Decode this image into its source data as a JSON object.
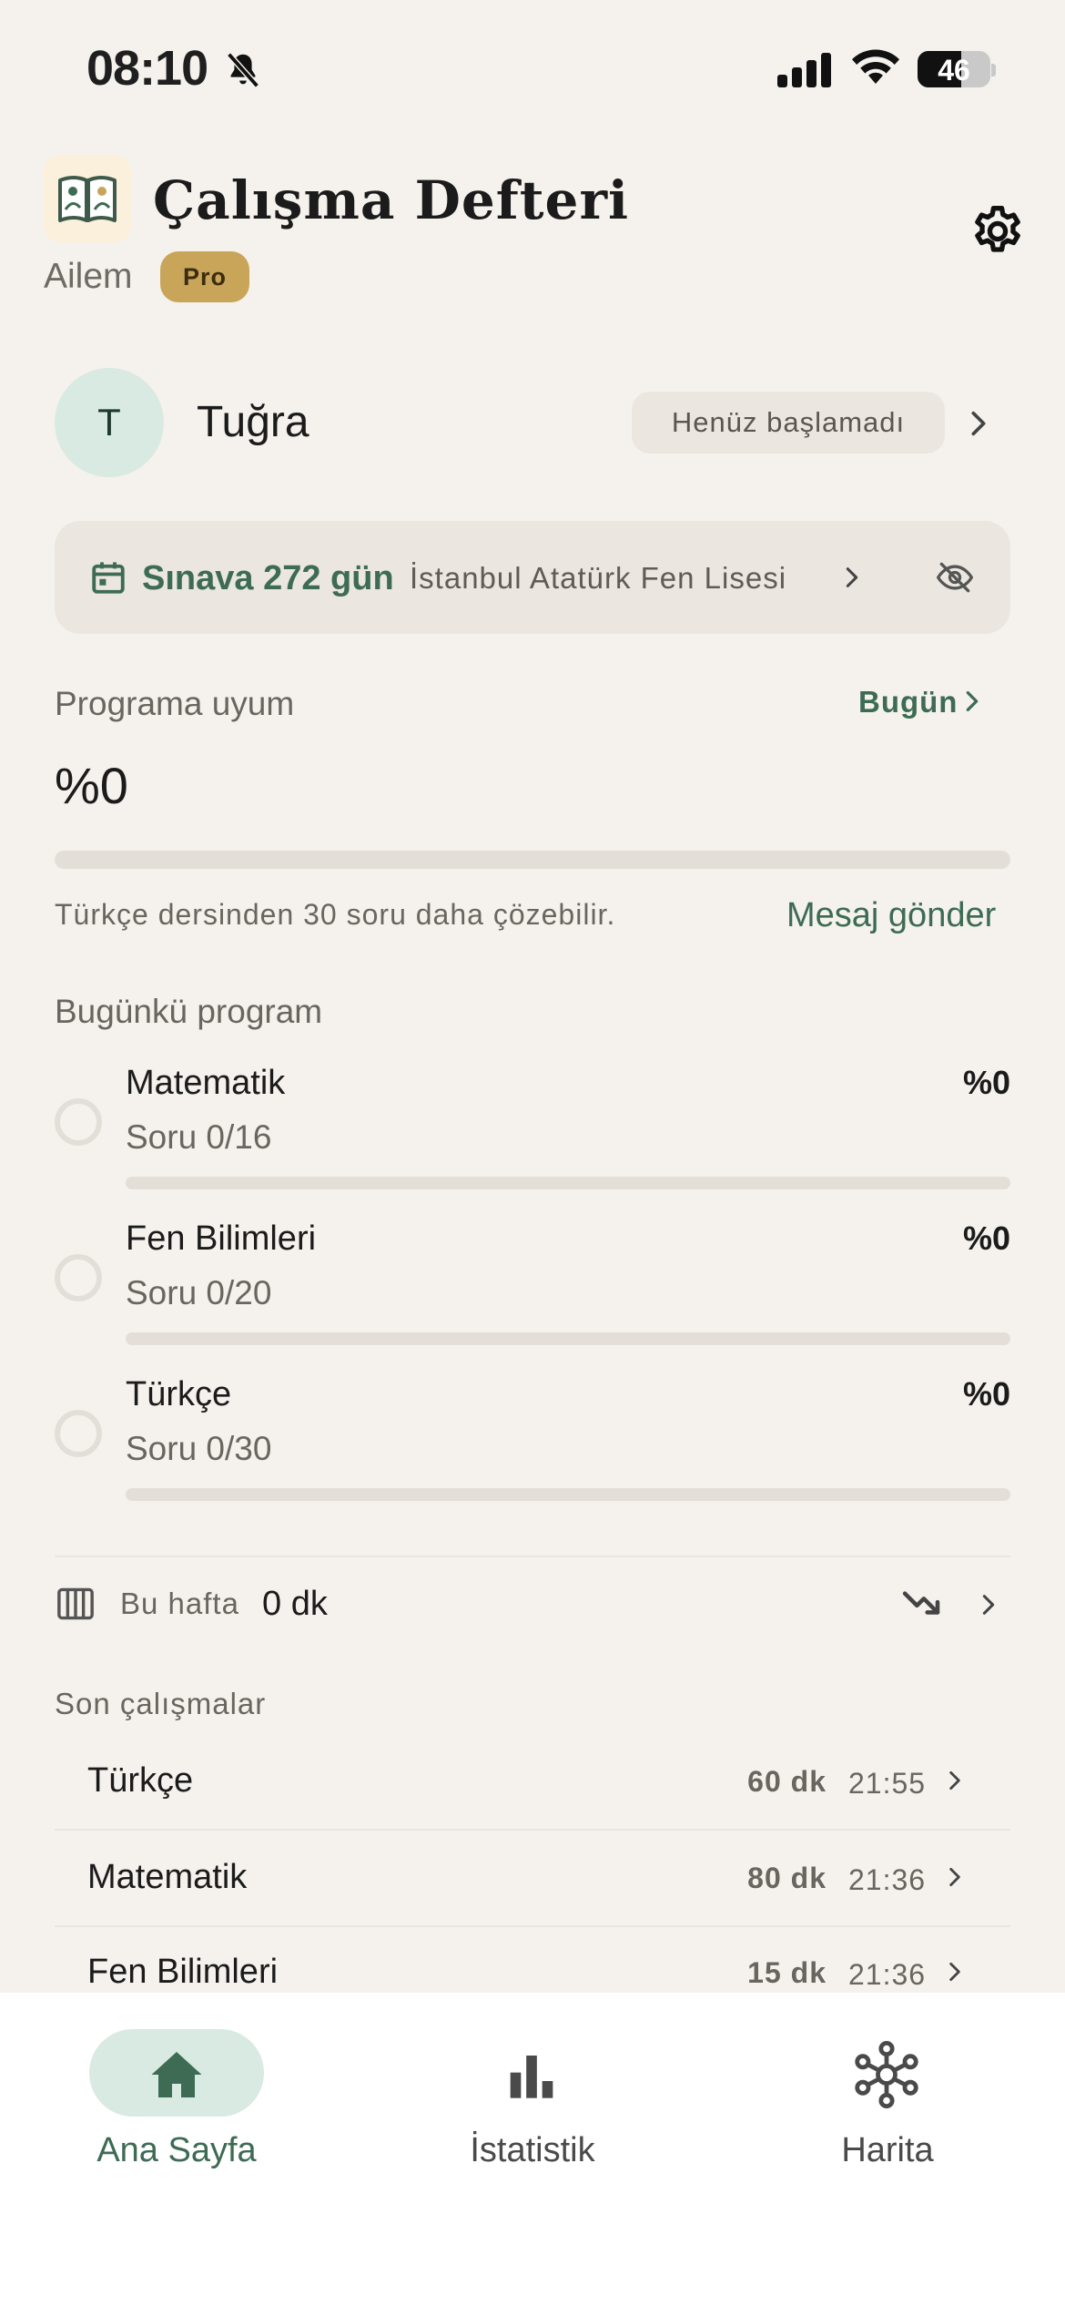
{
  "status_bar": {
    "time": "08:10",
    "battery": "46"
  },
  "header": {
    "title": "Çalışma Defteri",
    "subtitle": "Ailem",
    "badge": "Pro"
  },
  "student": {
    "initial": "T",
    "name": "Tuğra",
    "status": "Henüz başlamadı"
  },
  "exam": {
    "countdown": "Sınava 272 gün",
    "school": "İstanbul Atatürk Fen Lisesi"
  },
  "adherence": {
    "label": "Programa uyum",
    "today_link": "Bugün",
    "percent": "%0",
    "progress": 0,
    "hint": "Türkçe dersinden 30 soru daha çözebilir.",
    "message_link": "Mesaj gönder"
  },
  "program": {
    "label": "Bugünkü program",
    "items": [
      {
        "name": "Matematik",
        "soru": "Soru 0/16",
        "pct": "%0",
        "progress": 0
      },
      {
        "name": "Fen Bilimleri",
        "soru": "Soru 0/20",
        "pct": "%0",
        "progress": 0
      },
      {
        "name": "Türkçe",
        "soru": "Soru 0/30",
        "pct": "%0",
        "progress": 0
      }
    ]
  },
  "week": {
    "label": "Bu hafta",
    "value": "0 dk"
  },
  "recent": {
    "label": "Son çalışmalar",
    "items": [
      {
        "name": "Türkçe",
        "duration": "60 dk",
        "time": "21:55"
      },
      {
        "name": "Matematik",
        "duration": "80 dk",
        "time": "21:36"
      },
      {
        "name": "Fen Bilimleri",
        "duration": "15 dk",
        "time": "21:36"
      }
    ]
  },
  "nav": {
    "items": [
      {
        "label": "Ana Sayfa",
        "icon": "home-icon",
        "active": true
      },
      {
        "label": "İstatistik",
        "icon": "bar-chart-icon",
        "active": false
      },
      {
        "label": "Harita",
        "icon": "network-icon",
        "active": false
      }
    ]
  },
  "colors": {
    "accent": "#3d6b53",
    "background": "#f5f2ed",
    "pro_badge": "#c9a55a",
    "avatar_bg": "#d8eae2"
  }
}
